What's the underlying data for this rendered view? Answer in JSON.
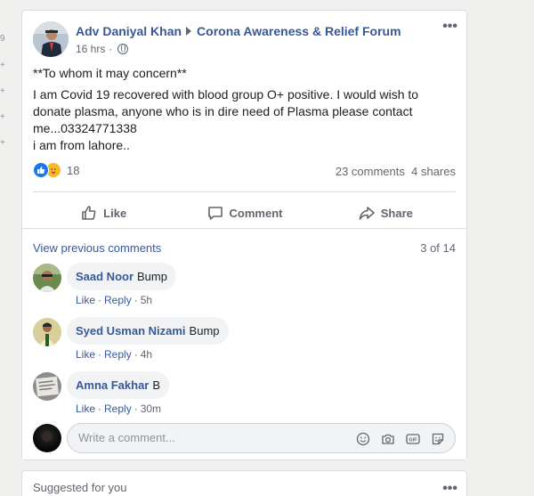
{
  "left_strip": [
    "9",
    "+",
    "+",
    "+",
    "+"
  ],
  "post": {
    "author": "Adv Daniyal Khan",
    "group": "Corona Awareness & Relief Forum",
    "time": "16 hrs",
    "separator": "·",
    "more": "•••",
    "text": {
      "line1": "**To whom it may concern**",
      "line2": "I am Covid 19 recovered with blood group O+ positive. I would wish to donate plasma, anyone who is in dire need of Plasma please contact me...03324771338",
      "line3": "i am from lahore.."
    },
    "reactions": {
      "count": "18",
      "types": [
        "like-icon",
        "care-icon"
      ]
    },
    "comments_count": "23 comments",
    "shares_count": "4 shares",
    "actions": {
      "like": "Like",
      "comment": "Comment",
      "share": "Share"
    }
  },
  "comments": {
    "view_previous": "View previous comments",
    "page_count": "3 of 14",
    "items": [
      {
        "name": "Saad Noor",
        "text": "Bump",
        "like": "Like",
        "reply": "Reply",
        "time": "5h"
      },
      {
        "name": "Syed Usman Nizami",
        "text": "Bump",
        "like": "Like",
        "reply": "Reply",
        "time": "4h"
      },
      {
        "name": "Amna Fakhar",
        "text": "B",
        "like": "Like",
        "reply": "Reply",
        "time": "30m"
      }
    ],
    "dot": "·",
    "write_placeholder": "Write a comment...",
    "gif_label": "GIF"
  },
  "suggested": {
    "title": "Suggested for you",
    "more": "•••"
  },
  "colors": {
    "link": "#385898",
    "like_blue": "#1877f2",
    "care_yellow": "#f7b928",
    "muted": "#606770"
  }
}
